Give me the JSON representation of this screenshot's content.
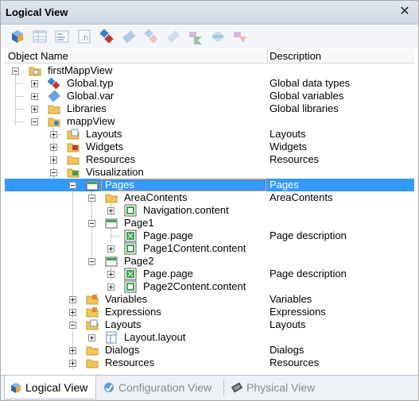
{
  "window": {
    "title": "Logical View",
    "close_glyph": "✕"
  },
  "toolbar": {
    "buttons": [
      {
        "name": "view-cube-icon"
      },
      {
        "name": "table-icon"
      },
      {
        "name": "properties-icon"
      },
      {
        "name": "header-file-icon"
      },
      {
        "name": "network-icon"
      },
      {
        "name": "edit-icon"
      },
      {
        "name": "network-edit-icon"
      },
      {
        "name": "erase-icon"
      },
      {
        "name": "arrow-right-icon"
      },
      {
        "name": "sync-icon"
      },
      {
        "name": "delete-arrow-icon"
      }
    ]
  },
  "columns": {
    "name": "Object Name",
    "description": "Description"
  },
  "tree": [
    {
      "label": "firstMappView",
      "desc": "",
      "icon": "project-folder-icon"
    },
    {
      "label": "Global.typ",
      "desc": "Global data types",
      "icon": "datatype-file-icon"
    },
    {
      "label": "Global.var",
      "desc": "Global variables",
      "icon": "variable-file-icon"
    },
    {
      "label": "Libraries",
      "desc": "Global libraries",
      "icon": "folder-icon"
    },
    {
      "label": "mappView",
      "desc": "",
      "icon": "mappview-folder-icon"
    },
    {
      "label": "Layouts",
      "desc": "Layouts",
      "icon": "layouts-folder-icon"
    },
    {
      "label": "Widgets",
      "desc": "Widgets",
      "icon": "widgets-folder-icon"
    },
    {
      "label": "Resources",
      "desc": "Resources",
      "icon": "folder-icon"
    },
    {
      "label": "Visualization",
      "desc": "",
      "icon": "visualization-folder-icon"
    },
    {
      "label": "Pages",
      "desc": "Pages",
      "icon": "pages-folder-icon"
    },
    {
      "label": "AreaContents",
      "desc": "AreaContents",
      "icon": "folder-icon"
    },
    {
      "label": "Navigation.content",
      "desc": "",
      "icon": "content-file-icon"
    },
    {
      "label": "Page1",
      "desc": "",
      "icon": "page-folder-icon"
    },
    {
      "label": "Page.page",
      "desc": "Page description",
      "icon": "page-file-icon"
    },
    {
      "label": "Page1Content.content",
      "desc": "",
      "icon": "content-file-icon"
    },
    {
      "label": "Page2",
      "desc": "",
      "icon": "page-folder-icon"
    },
    {
      "label": "Page.page",
      "desc": "Page description",
      "icon": "page-file-icon"
    },
    {
      "label": "Page2Content.content",
      "desc": "",
      "icon": "content-file-icon"
    },
    {
      "label": "Variables",
      "desc": "Variables",
      "icon": "variables-folder-icon"
    },
    {
      "label": "Expressions",
      "desc": "Expressions",
      "icon": "expressions-folder-icon"
    },
    {
      "label": "Layouts",
      "desc": "Layouts",
      "icon": "layouts-folder-icon"
    },
    {
      "label": "Layout.layout",
      "desc": "",
      "icon": "layout-file-icon"
    },
    {
      "label": "Dialogs",
      "desc": "Dialogs",
      "icon": "folder-icon"
    },
    {
      "label": "Resources",
      "desc": "Resources",
      "icon": "folder-icon"
    }
  ],
  "tabs": [
    {
      "label": "Logical View",
      "active": true,
      "icon": "logical-view-icon"
    },
    {
      "label": "Configuration View",
      "active": false,
      "icon": "configuration-view-icon"
    },
    {
      "label": "Physical View",
      "active": false,
      "icon": "physical-view-icon"
    }
  ],
  "colors": {
    "selection": "#3399ff",
    "selection_border": "#e8a15a",
    "folder": "#f2c45a"
  }
}
